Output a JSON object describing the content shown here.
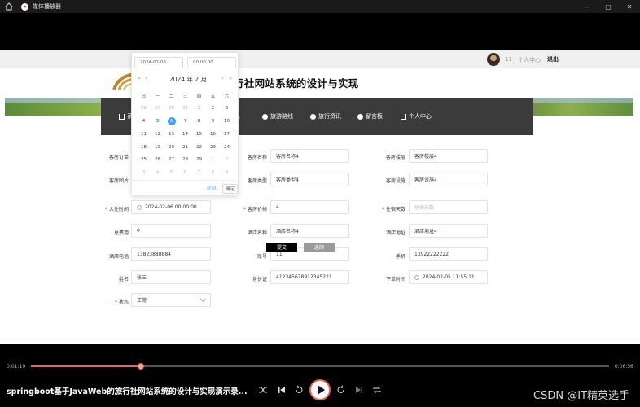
{
  "window": {
    "title": "媒体播放器",
    "controls": [
      "—",
      "▢",
      "✕"
    ]
  },
  "site": {
    "title": "行社网站系统的设计与实现",
    "user": {
      "name": "11",
      "center": "个人中心",
      "logout": "退出"
    },
    "nav": [
      {
        "label": "系",
        "icon": "home-icon"
      },
      {
        "label": "息",
        "icon": ""
      },
      {
        "label": "旅游路线",
        "icon": "route-icon"
      },
      {
        "label": "旅行资讯",
        "icon": "news-icon"
      },
      {
        "label": "留言板",
        "icon": "message-icon"
      },
      {
        "label": "个人中心",
        "icon": "home-icon"
      }
    ]
  },
  "datepicker": {
    "date_input": "2024-02-06",
    "time_input": "00:00:00",
    "title": "2024 年  2 月",
    "prev_year": "«",
    "prev_month": "‹",
    "next_month": "›",
    "next_year": "»",
    "weekdays": [
      "日",
      "一",
      "二",
      "三",
      "四",
      "五",
      "六"
    ],
    "weeks": [
      [
        "28",
        "29",
        "30",
        "31",
        "1",
        "2",
        "3"
      ],
      [
        "4",
        "5",
        "6",
        "7",
        "8",
        "9",
        "10"
      ],
      [
        "11",
        "12",
        "13",
        "14",
        "15",
        "16",
        "17"
      ],
      [
        "18",
        "19",
        "20",
        "21",
        "22",
        "23",
        "24"
      ],
      [
        "25",
        "26",
        "27",
        "28",
        "29",
        "1",
        "2"
      ],
      [
        "3",
        "4",
        "5",
        "6",
        "7",
        "8",
        "9"
      ]
    ],
    "now_label": "此刻",
    "ok_label": "确定"
  },
  "form": {
    "fields": {
      "room_order": {
        "label": "客房订单",
        "value": ""
      },
      "room_name": {
        "label": "客房名称",
        "value": "客房名称4"
      },
      "room_floor": {
        "label": "客房楼层",
        "value": "客房楼层4"
      },
      "room_image": {
        "label": "客房图片",
        "value": ""
      },
      "room_type": {
        "label": "客房类型",
        "value": "客房类型4"
      },
      "room_facility": {
        "label": "客房设施",
        "value": "客房设施4"
      },
      "checkin_time": {
        "label": "入住时间",
        "value": "2024-02-06 00:00:00",
        "required": "*"
      },
      "room_price": {
        "label": "客房价格",
        "value": "4",
        "required": "*"
      },
      "stay_days": {
        "label": "住宿天数",
        "placeholder": "住宿天数",
        "required": "*"
      },
      "total_cost": {
        "label": "总费用",
        "value": "0"
      },
      "hotel_name": {
        "label": "酒店名称",
        "value": "酒店名称4"
      },
      "hotel_address": {
        "label": "酒店地址",
        "value": "酒店地址4"
      },
      "hotel_phone": {
        "label": "酒店电话",
        "value": "13823888884"
      },
      "account": {
        "label": "账号",
        "value": "11"
      },
      "mobile": {
        "label": "手机",
        "value": "13922222222"
      },
      "name": {
        "label": "姓名",
        "value": "张三"
      },
      "id_card": {
        "label": "身份证",
        "value": "412345678912345221"
      },
      "order_time": {
        "label": "下单时间",
        "value": "2024-02-05 11:55:11"
      },
      "status": {
        "label": "状态",
        "value": "正常",
        "required": "*"
      }
    },
    "submit_label": "提交",
    "back_label": "返回"
  },
  "player": {
    "current_time": "0:01:19",
    "total_time": "0:06:56",
    "progress": 0.19,
    "video_title": "springboot基于JavaWeb的旅行社网站系统的设计与实现演示录...",
    "accent_color": "#e8694a"
  },
  "watermark": "CSDN @IT精英选手"
}
